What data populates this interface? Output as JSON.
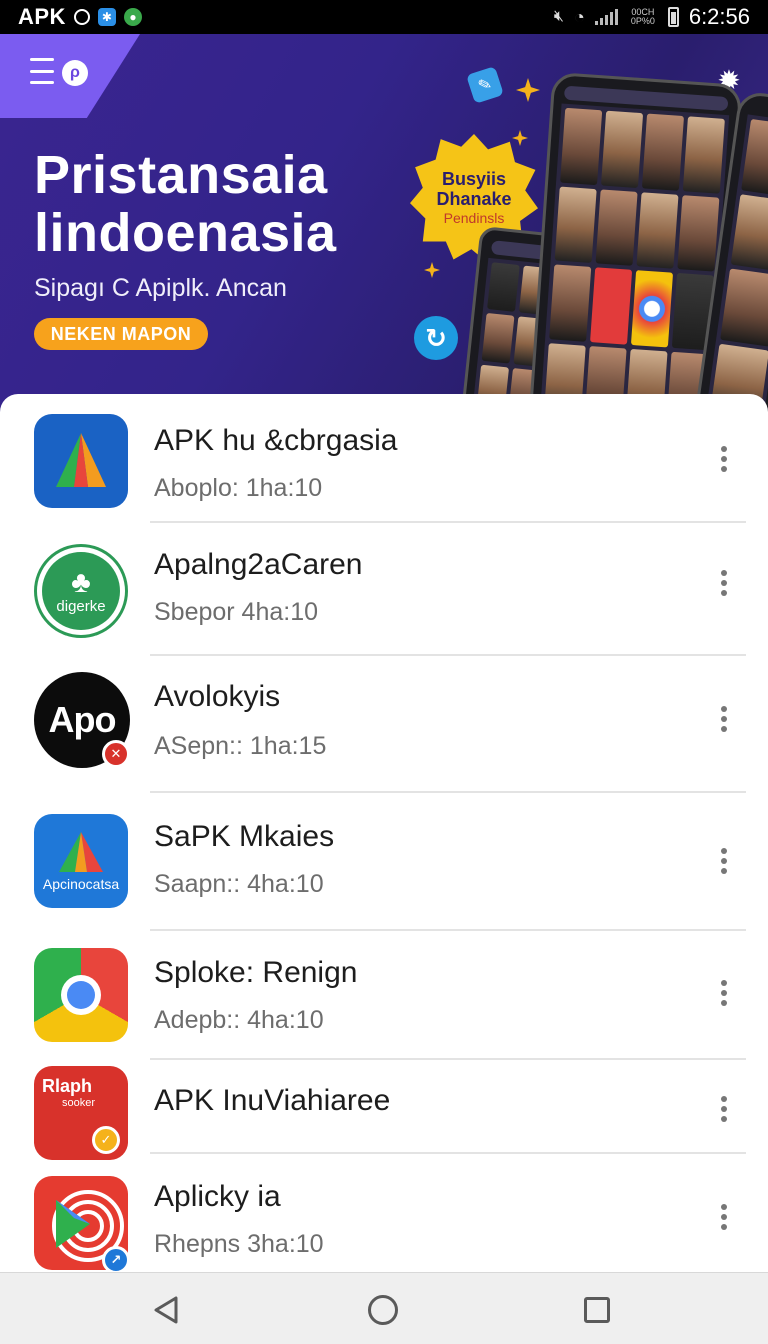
{
  "status_bar": {
    "app_label": "APK",
    "time": "6:2:56",
    "mini_text_top": "00CH",
    "mini_text_bottom": "0P%0"
  },
  "hero": {
    "title_line1": "Pristansaia",
    "title_line2": "lindoenasia",
    "subtitle": "Sipagı C Apiplk. Ancan",
    "cta": "NEKEN MAPON",
    "badge_line1": "Busyiis",
    "badge_line2": "Dhanake",
    "badge_line3": "Pendinsls"
  },
  "apps": [
    {
      "title": "APK hu &cbrgasia",
      "subtitle": "Aboplo: 1ha:10",
      "icon": "apk-drive-icon",
      "icon_text": ""
    },
    {
      "title": "Apalng2aCaren",
      "subtitle": "Sbepor 4ha:10",
      "icon": "leaf-badge-icon",
      "icon_text": "digerke"
    },
    {
      "title": "Avolokyis",
      "subtitle": "ASepn:: 1ha:15",
      "icon": "apo-circle-icon",
      "icon_text": "Apo"
    },
    {
      "title": "SaPK Mkaies",
      "subtitle": "Saapn:: 4ha:10",
      "icon": "apk-triangle-icon",
      "icon_text": "Apcinocatsa"
    },
    {
      "title": "Sploke: Renign",
      "subtitle": "Adepb:: 4ha:10",
      "icon": "chrome-icon",
      "icon_text": ""
    },
    {
      "title": "APK InuViahiaree",
      "subtitle": "",
      "icon": "rlaph-sticker-icon",
      "icon_text": "Rlaph",
      "icon_text2": "sooker"
    },
    {
      "title": "Aplicky ia",
      "subtitle": "Rhepns 3ha:10",
      "icon": "play-target-icon",
      "icon_text": ""
    }
  ],
  "colors": {
    "hero_bg": "#33248a",
    "accent_orange": "#f7a21c",
    "badge_yellow": "#f5c417",
    "corner_purple": "#7b5cf0"
  }
}
